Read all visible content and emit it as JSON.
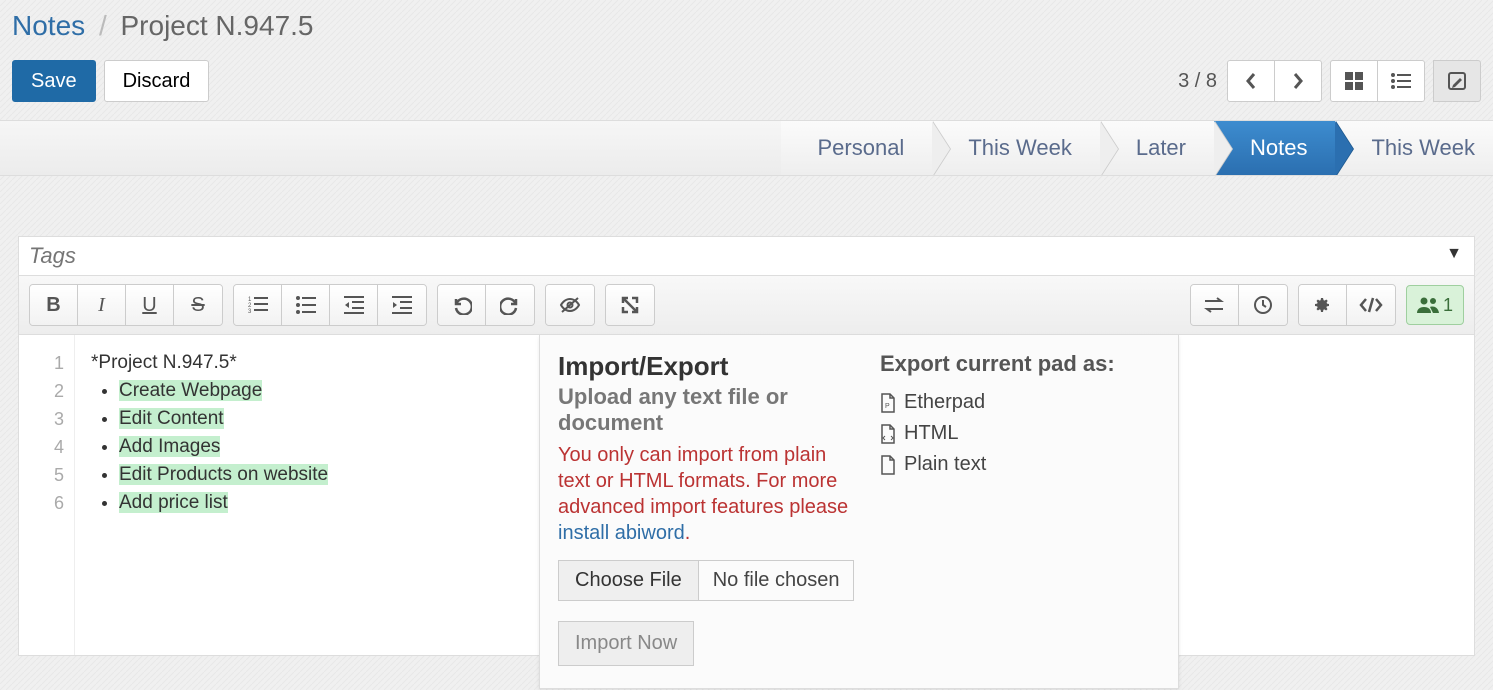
{
  "breadcrumb": {
    "root": "Notes",
    "sep": "/",
    "title": "Project N.947.5"
  },
  "actions": {
    "save": "Save",
    "discard": "Discard",
    "pager": "3 / 8"
  },
  "tabs": [
    "Personal",
    "This Week",
    "Later",
    "Notes",
    "This Week"
  ],
  "tabs_active": 3,
  "tags": {
    "placeholder": "Tags"
  },
  "users_count": "1",
  "editor": {
    "gutter": [
      "1",
      "2",
      "3",
      "4",
      "5",
      "6"
    ],
    "title": "*Project N.947.5*",
    "items": [
      "Create Webpage",
      "Edit Content",
      "Add Images",
      "Edit Products on website",
      "Add price list"
    ]
  },
  "popup": {
    "heading": "Import/Export",
    "subheading": "Upload any text file or document",
    "warning_pre": "You only can import from plain text or HTML formats. For more advanced import features please ",
    "warning_link": "install abiword",
    "warning_post": ".",
    "choose_file": "Choose File",
    "no_file": "No file chosen",
    "import_now": "Import Now",
    "export_heading": "Export current pad as:",
    "exports": [
      "Etherpad",
      "HTML",
      "Plain text"
    ]
  }
}
